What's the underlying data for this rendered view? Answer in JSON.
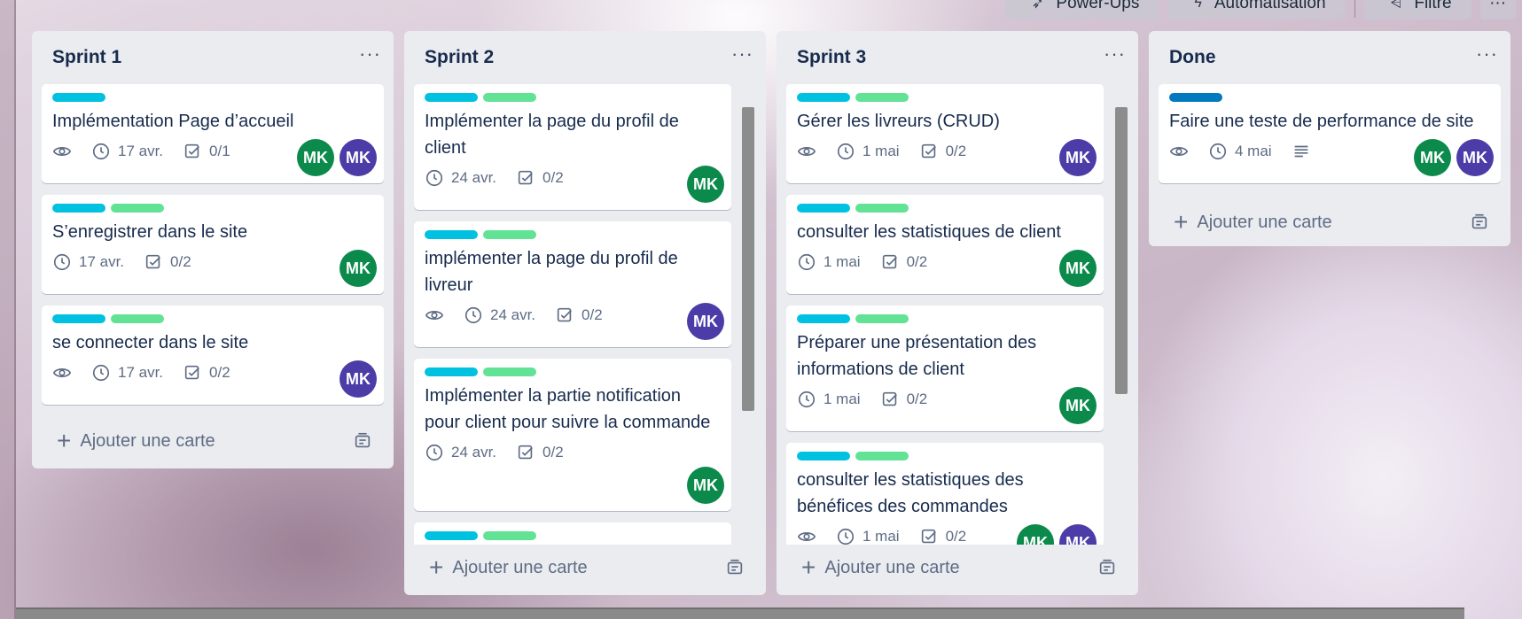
{
  "toolbar": {
    "powerups_label": "Power-Ups",
    "automation_label": "Automatisation",
    "filter_label": "Filtre"
  },
  "add_card_label": "Ajouter une carte",
  "lists": [
    {
      "title": "Sprint 1",
      "cards": [
        {
          "labels": [
            "cyan"
          ],
          "title": "Implémentation Page d’accueil",
          "watch": true,
          "due": "17 avr.",
          "checklist": "0/1",
          "avatars": [
            "MK",
            "MK"
          ]
        },
        {
          "labels": [
            "cyan",
            "green"
          ],
          "title": "S’enregistrer dans le site",
          "watch": false,
          "due": "17 avr.",
          "checklist": "0/2",
          "avatars": [
            "MK"
          ]
        },
        {
          "labels": [
            "cyan",
            "green"
          ],
          "title": "se connecter dans le site",
          "watch": true,
          "due": "17 avr.",
          "checklist": "0/2",
          "avatars": [
            "MK"
          ]
        }
      ]
    },
    {
      "title": "Sprint 2",
      "cards": [
        {
          "labels": [
            "cyan",
            "green"
          ],
          "title": "Implémenter la page du profil de client",
          "due": "24 avr.",
          "checklist": "0/2",
          "avatars": [
            "MK"
          ]
        },
        {
          "labels": [
            "cyan",
            "green"
          ],
          "title": "implémenter la page du profil de livreur",
          "watch": true,
          "due": "24 avr.",
          "checklist": "0/2",
          "avatars": [
            "MK"
          ]
        },
        {
          "labels": [
            "cyan",
            "green"
          ],
          "title": "Implémenter la partie notification pour client pour suivre la commande",
          "due": "24 avr.",
          "checklist": "0/2",
          "avatars": [
            "MK"
          ]
        }
      ]
    },
    {
      "title": "Sprint 3",
      "cards": [
        {
          "labels": [
            "cyan",
            "green"
          ],
          "title": "Gérer les livreurs (CRUD)",
          "watch": true,
          "due": "1 mai",
          "checklist": "0/2",
          "avatars": [
            "MK"
          ]
        },
        {
          "labels": [
            "cyan",
            "green"
          ],
          "title": "consulter les statistiques de client",
          "due": "1 mai",
          "checklist": "0/2",
          "avatars": [
            "MK"
          ]
        },
        {
          "labels": [
            "cyan",
            "green"
          ],
          "title": "Préparer une présentation des informations de client",
          "due": "1 mai",
          "checklist": "0/2",
          "avatars": [
            "MK"
          ]
        },
        {
          "labels": [
            "cyan",
            "green"
          ],
          "title": "consulter les statistiques des bénéfices des commandes",
          "watch": true,
          "due": "1 mai",
          "checklist": "0/2",
          "avatars": [
            "MK",
            "MK"
          ]
        }
      ]
    },
    {
      "title": "Done",
      "cards": [
        {
          "labels": [
            "blue"
          ],
          "title": "Faire une teste de performance de site",
          "watch": true,
          "due": "4 mai",
          "description": true,
          "avatars": [
            "MK",
            "MK"
          ]
        }
      ]
    }
  ],
  "colors": {
    "label_cyan": "#00c2e0",
    "label_green": "#61e294",
    "label_blue": "#0079bf",
    "avatar_green": "#0b8a4c",
    "avatar_purple": "#4c3ca8"
  }
}
